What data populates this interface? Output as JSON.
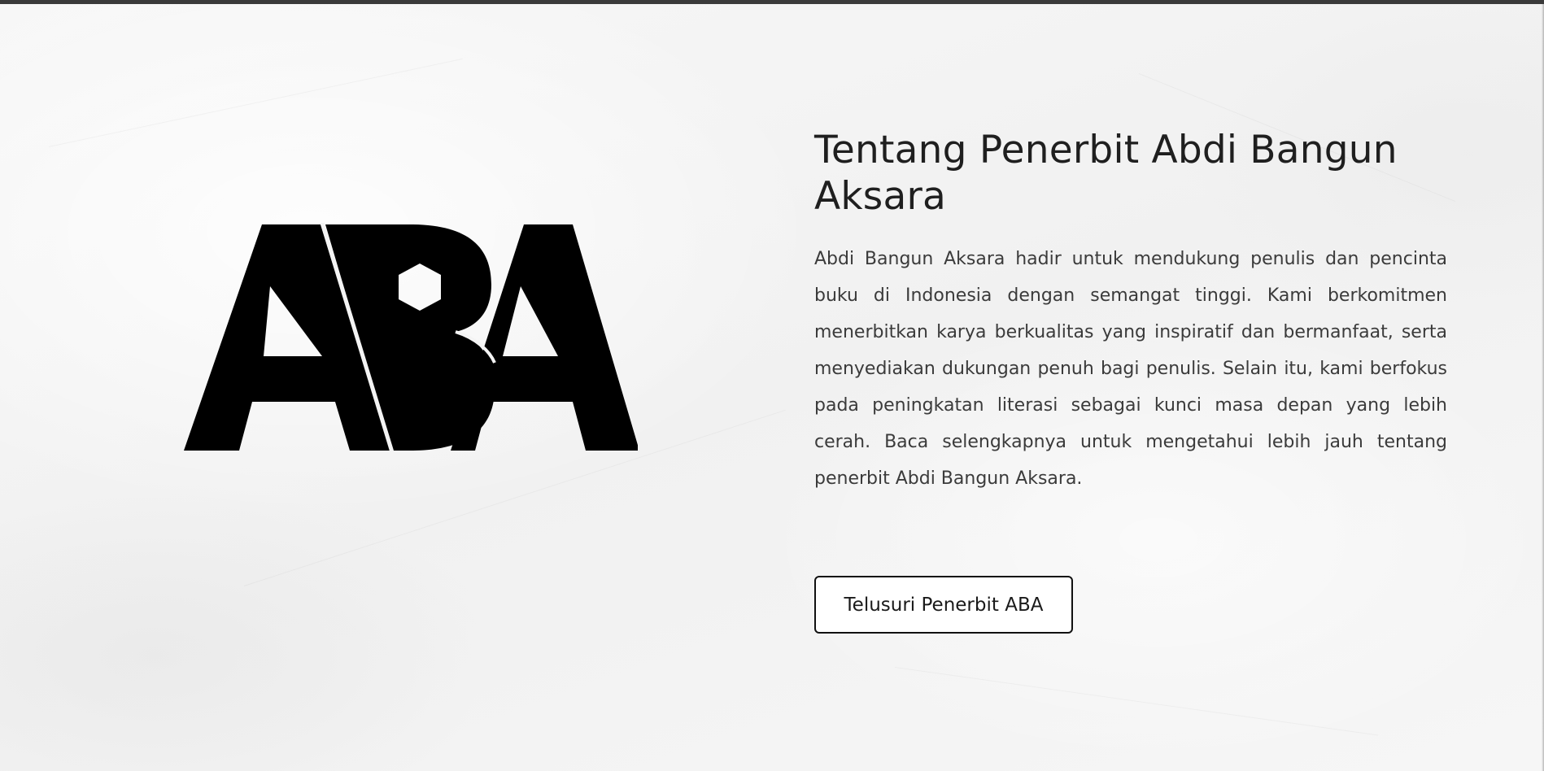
{
  "logo": {
    "alt_text": "ABA",
    "color": "#000000"
  },
  "about": {
    "title": "Tentang Penerbit Abdi Bangun Aksara",
    "description": "Abdi Bangun Aksara hadir untuk mendukung penulis dan pencinta buku di Indonesia dengan semangat tinggi. Kami berkomitmen menerbitkan karya berkualitas yang inspiratif dan bermanfaat, serta menyediakan dukungan penuh bagi penulis. Selain itu, kami berfokus pada peningkatan literasi sebagai kunci masa depan yang lebih cerah. Baca selengkapnya untuk mengetahui lebih jauh tentang penerbit Abdi Bangun Aksara.",
    "cta_label": "Telusuri Penerbit ABA"
  },
  "colors": {
    "top_bar": "#3a3a3a",
    "background": "#f4f4f4",
    "title_text": "#1f1f1f",
    "body_text": "#3b3b3b",
    "button_border": "#111111"
  }
}
